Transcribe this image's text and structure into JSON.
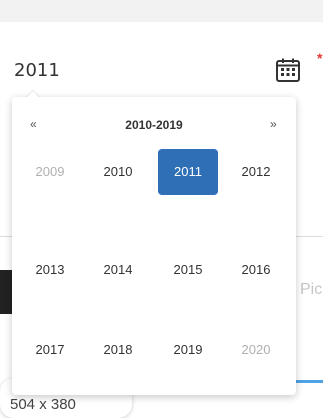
{
  "input": {
    "value": "2011"
  },
  "required_mark": "*",
  "background": {
    "hint_text": "Pic",
    "chip_text": "504 x 380"
  },
  "datepicker": {
    "prev": "«",
    "next": "»",
    "range_label": "2010-2019",
    "years": [
      {
        "label": "2009",
        "state": "muted"
      },
      {
        "label": "2010",
        "state": "normal"
      },
      {
        "label": "2011",
        "state": "active"
      },
      {
        "label": "2012",
        "state": "normal"
      },
      {
        "label": "2013",
        "state": "normal"
      },
      {
        "label": "2014",
        "state": "normal"
      },
      {
        "label": "2015",
        "state": "normal"
      },
      {
        "label": "2016",
        "state": "normal"
      },
      {
        "label": "2017",
        "state": "normal"
      },
      {
        "label": "2018",
        "state": "normal"
      },
      {
        "label": "2019",
        "state": "normal"
      },
      {
        "label": "2020",
        "state": "muted"
      }
    ]
  },
  "colors": {
    "active": "#2e6fb5",
    "muted": "#b0b0b0",
    "text": "#333333"
  },
  "icons": {
    "calendar": "calendar-icon"
  }
}
